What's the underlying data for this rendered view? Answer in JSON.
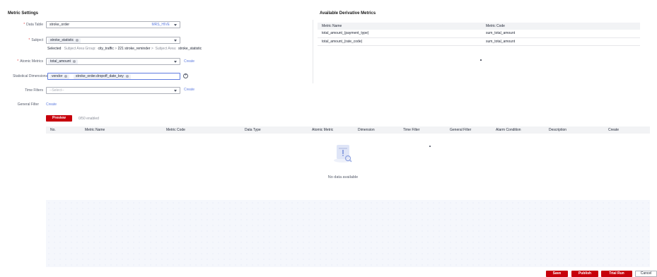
{
  "metric_settings": {
    "title": "Metric Settings",
    "data_table": {
      "label": "Data Table",
      "value": "stroke_order",
      "badge": "MRS_HIVE"
    },
    "subject": {
      "label": "Subject",
      "tag": "stroke_statistic",
      "selected_prefix": "Selected",
      "group_label": "Subject Area Group:",
      "path": [
        "city_traffic",
        ">",
        "221 stroke_reminder",
        ">"
      ],
      "area_label": "Subject Area:",
      "area_value": "stroke_statistic"
    },
    "atomic_metrics": {
      "label": "Atomic Metrics",
      "tag": "total_amount",
      "create_link": "Create"
    },
    "statistical_dimensions": {
      "label": "Statistical Dimensions",
      "tags": [
        "vendor",
        "stroke_order.dropoff_date_key"
      ]
    },
    "time_filters": {
      "label": "Time Filters",
      "placeholder": "--Select--",
      "create_link": "Create"
    },
    "general_filter": {
      "label": "General Filter",
      "create_link": "Create"
    },
    "preview_button": "Preview",
    "enabled_count": "0/50 enabled"
  },
  "derivative_metrics": {
    "title": "Available Derivative Metrics",
    "columns": [
      "Metric Name",
      "Metric Code"
    ],
    "rows": [
      [
        "total_amount_(payment_type)",
        "sum_total_amount"
      ],
      [
        "total_amount_(rate_code)",
        "sum_total_amount"
      ]
    ]
  },
  "metrics_table": {
    "columns": [
      "No.",
      "Metric Name",
      "Metric Code",
      "Data Type",
      "Atomic Metric",
      "Dimension",
      "Time Filter",
      "General Filter",
      "Alarm Condition",
      "Description",
      "Create"
    ],
    "empty_text": "No data available"
  },
  "footer": {
    "save": "Save",
    "publish": "Publish",
    "trial_run": "Trial Run",
    "cancel": "Cancel"
  },
  "colors": {
    "primary_red": "#c7000b",
    "link_blue": "#5e7ce0",
    "required_red": "#e54545"
  }
}
